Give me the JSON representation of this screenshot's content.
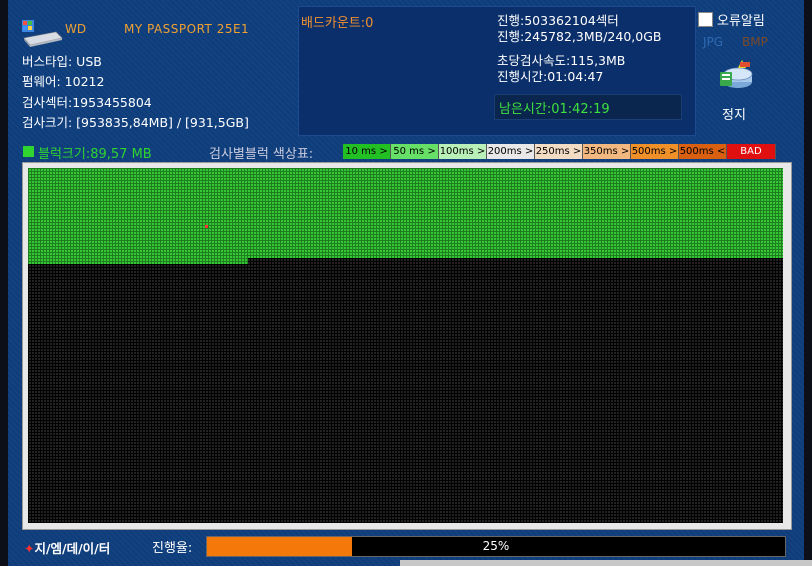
{
  "drive": {
    "brand": "WD",
    "model": "MY PASSPORT 25E1",
    "bus_type": "버스타입: USB",
    "firmware": "펌웨어: 10212",
    "sectors": "검사섹터:1953455804",
    "size": "검사크기: [953835,84MB] / [931,5GB]"
  },
  "bad_count": "배드카운트:0",
  "stats": {
    "progress_sectors": "진행:503362104섹터",
    "progress_bytes": "진행:245782,3MB/240,0GB",
    "speed": "초당검사속도:115,3MB",
    "elapsed": "진행시간:01:04:47",
    "remaining": "남은시간:01:42:19"
  },
  "controls": {
    "error_alarm_label": "오류알림",
    "error_alarm_checked": false,
    "jpg_label": "JPG",
    "bmp_label": "BMP",
    "stop_label": "정지"
  },
  "legend": {
    "block_size": "블럭크기:89,57 MB",
    "title": "검사별블럭 색상표:",
    "items": [
      {
        "label": "10 ms >",
        "color": "#22c022"
      },
      {
        "label": "50 ms >",
        "color": "#66e066"
      },
      {
        "label": "100ms >",
        "color": "#b8f0b8"
      },
      {
        "label": "200ms >",
        "color": "#e8e8e8"
      },
      {
        "label": "250ms >",
        "color": "#f3dcc4"
      },
      {
        "label": "350ms >",
        "color": "#f3b880"
      },
      {
        "label": "500ms >",
        "color": "#f09028"
      },
      {
        "label": "500ms <",
        "color": "#d86010"
      },
      {
        "label": "BAD",
        "color": "#e01010"
      }
    ]
  },
  "footer": {
    "logo_prefix": "✦",
    "logo_text": "지/엠/데/이/터",
    "progress_label": "진행율:",
    "progress_percent": 25,
    "progress_text": "25%"
  },
  "colors": {
    "background": "#0e3d7c",
    "accent_orange": "#f0a030",
    "ok_green": "#34c934",
    "progress_orange": "#f5780a"
  }
}
